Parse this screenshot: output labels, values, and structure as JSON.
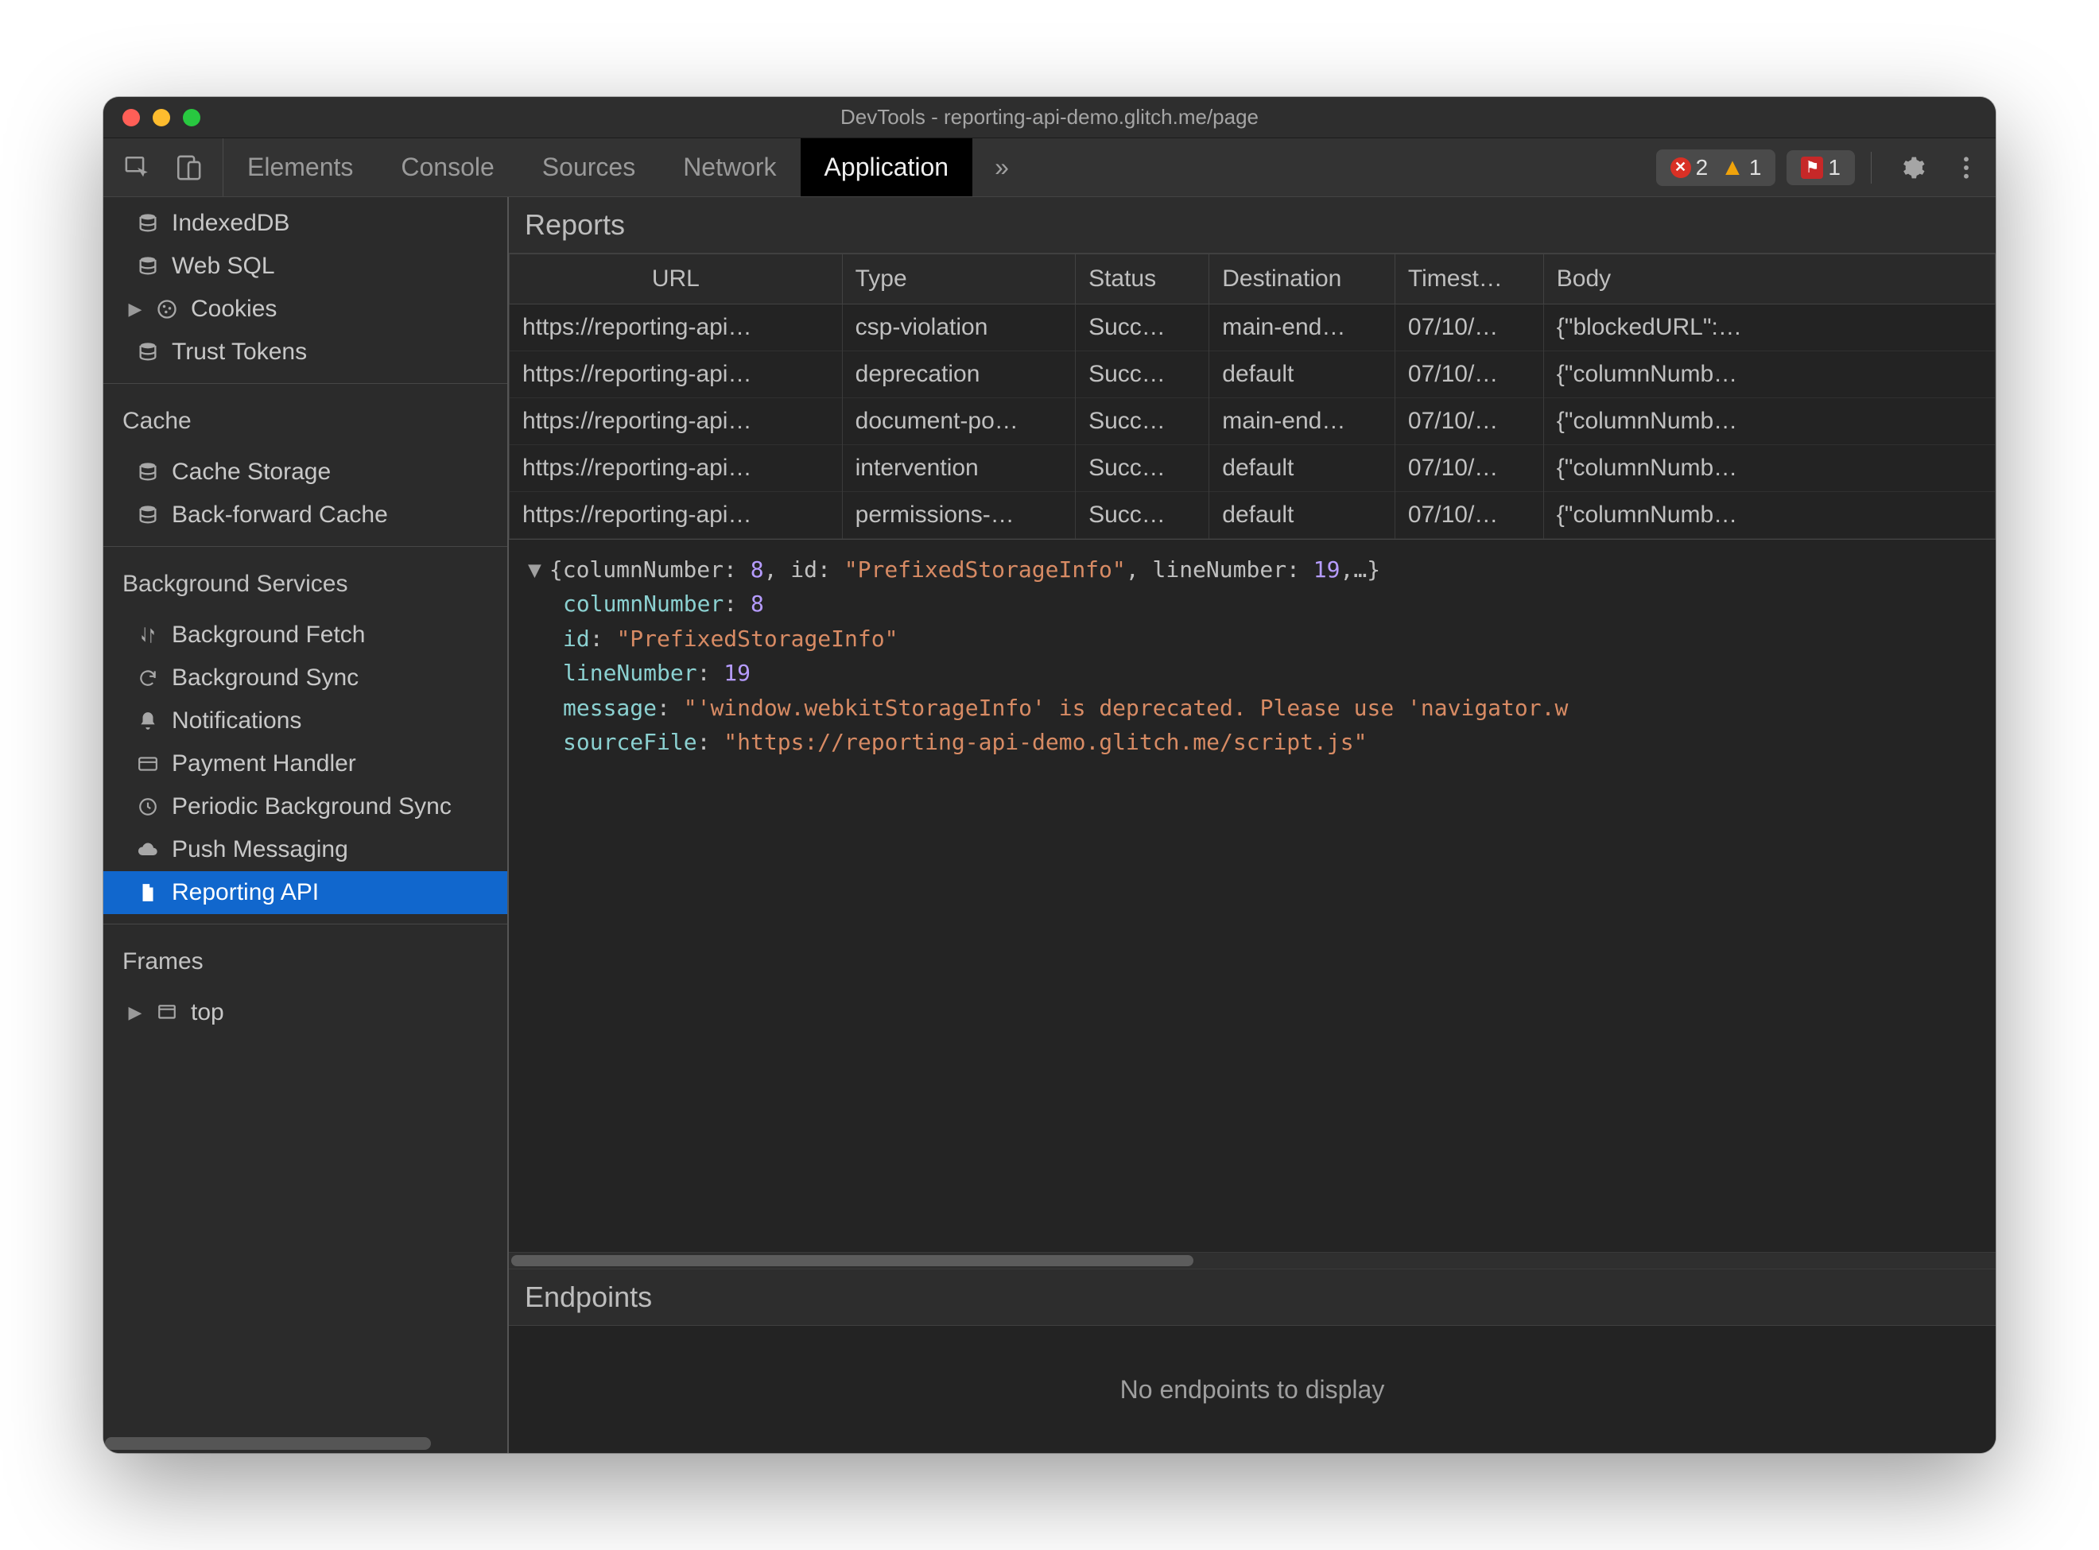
{
  "window_title": "DevTools - reporting-api-demo.glitch.me/page",
  "toolbar": {
    "tabs": [
      "Elements",
      "Console",
      "Sources",
      "Network",
      "Application"
    ],
    "active_tab": "Application",
    "overflow": "»",
    "errors": "2",
    "warnings": "1",
    "violations": "1"
  },
  "sidebar": {
    "storage_items": [
      {
        "icon": "db",
        "label": "IndexedDB",
        "caret": false
      },
      {
        "icon": "db",
        "label": "Web SQL",
        "caret": false
      },
      {
        "icon": "cookie",
        "label": "Cookies",
        "caret": true
      },
      {
        "icon": "db",
        "label": "Trust Tokens",
        "caret": false
      }
    ],
    "cache_header": "Cache",
    "cache_items": [
      {
        "icon": "db",
        "label": "Cache Storage"
      },
      {
        "icon": "db",
        "label": "Back-forward Cache"
      }
    ],
    "bg_header": "Background Services",
    "bg_items": [
      {
        "icon": "updown",
        "label": "Background Fetch"
      },
      {
        "icon": "sync",
        "label": "Background Sync"
      },
      {
        "icon": "bell",
        "label": "Notifications"
      },
      {
        "icon": "card",
        "label": "Payment Handler"
      },
      {
        "icon": "clock",
        "label": "Periodic Background Sync"
      },
      {
        "icon": "cloud",
        "label": "Push Messaging"
      },
      {
        "icon": "doc",
        "label": "Reporting API",
        "selected": true
      }
    ],
    "frames_header": "Frames",
    "frames_items": [
      {
        "icon": "frame",
        "label": "top",
        "caret": true
      }
    ]
  },
  "reports": {
    "title": "Reports",
    "headers": [
      "URL",
      "Type",
      "Status",
      "Destination",
      "Timest…",
      "Body"
    ],
    "rows": [
      {
        "url": "https://reporting-api…",
        "type": "csp-violation",
        "status": "Succ…",
        "dest": "main-end…",
        "ts": "07/10/…",
        "body": "{\"blockedURL\":…"
      },
      {
        "url": "https://reporting-api…",
        "type": "deprecation",
        "status": "Succ…",
        "dest": "default",
        "ts": "07/10/…",
        "body": "{\"columnNumb…"
      },
      {
        "url": "https://reporting-api…",
        "type": "document-po…",
        "status": "Succ…",
        "dest": "main-end…",
        "ts": "07/10/…",
        "body": "{\"columnNumb…"
      },
      {
        "url": "https://reporting-api…",
        "type": "intervention",
        "status": "Succ…",
        "dest": "default",
        "ts": "07/10/…",
        "body": "{\"columnNumb…"
      },
      {
        "url": "https://reporting-api…",
        "type": "permissions-…",
        "status": "Succ…",
        "dest": "default",
        "ts": "07/10/…",
        "body": "{\"columnNumb…"
      }
    ]
  },
  "detail": {
    "summary_pre": "{columnNumber: ",
    "summary_v1": "8",
    "summary_mid": ", id: ",
    "summary_v2": "\"PrefixedStorageInfo\"",
    "summary_mid2": ", lineNumber: ",
    "summary_v3": "19",
    "summary_post": ",…}",
    "k1": "columnNumber",
    "v1": "8",
    "k2": "id",
    "v2": "\"PrefixedStorageInfo\"",
    "k3": "lineNumber",
    "v3": "19",
    "k4": "message",
    "v4": "\"'window.webkitStorageInfo' is deprecated. Please use 'navigator.w",
    "k5": "sourceFile",
    "v5": "\"https://reporting-api-demo.glitch.me/script.js\""
  },
  "endpoints": {
    "title": "Endpoints",
    "empty": "No endpoints to display"
  }
}
